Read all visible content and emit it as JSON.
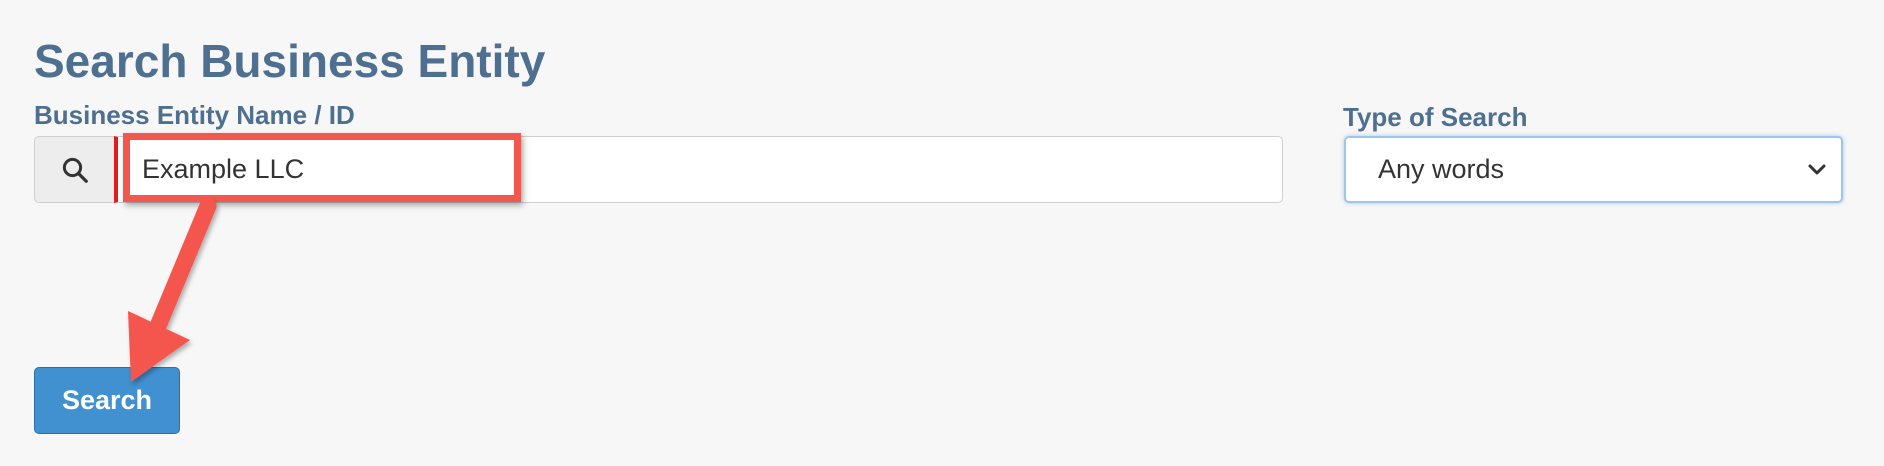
{
  "page": {
    "title": "Search Business Entity"
  },
  "form": {
    "name_label": "Business Entity Name / ID",
    "name_value": "Example LLC",
    "type_label": "Type of Search",
    "type_selected": "Any words",
    "search_button_label": "Search"
  },
  "icons": {
    "search_addon": "search-icon",
    "select_chevron": "chevron-down-icon"
  },
  "colors": {
    "heading": "#4e6f8f",
    "button": "#4190cf",
    "annotation": "#f4574d",
    "input_accent": "#e21b1b"
  }
}
